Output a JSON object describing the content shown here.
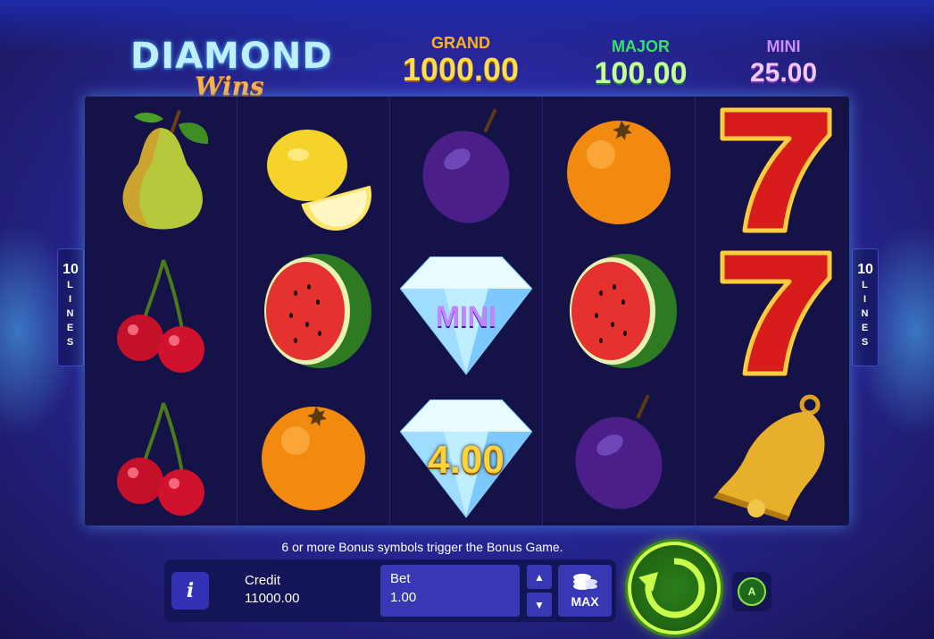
{
  "logo": {
    "title": "DIAMOND",
    "subtitle": "Wins"
  },
  "jackpots": {
    "grand": {
      "label": "GRAND",
      "value": "1000.00"
    },
    "major": {
      "label": "MAJOR",
      "value": "100.00"
    },
    "mini": {
      "label": "MINI",
      "value": "25.00"
    }
  },
  "paylines": {
    "count": "10",
    "text": [
      "L",
      "I",
      "N",
      "E",
      "S"
    ]
  },
  "reels": [
    [
      "pear",
      "cherries",
      "cherries"
    ],
    [
      "lemon",
      "watermelon",
      "orange"
    ],
    [
      "plum",
      "diamond-mini",
      "diamond-value"
    ],
    [
      "orange",
      "watermelon",
      "plum"
    ],
    [
      "seven",
      "seven",
      "bell"
    ]
  ],
  "diamond_labels": {
    "mini": "MINI",
    "value": "4.00"
  },
  "bonus_message": "6 or more Bonus symbols trigger the Bonus Game.",
  "controls": {
    "info_label": "i",
    "credit_label": "Credit",
    "credit_value": "11000.00",
    "bet_label": "Bet",
    "bet_value": "1.00",
    "max_label": "MAX",
    "auto_label": "A"
  },
  "colors": {
    "spin_ring": "#c9ff4a",
    "reel_bg": "#141247",
    "grand": "#ffdd4a",
    "major": "#c6ff9a",
    "mini": "#f0c8ff"
  }
}
